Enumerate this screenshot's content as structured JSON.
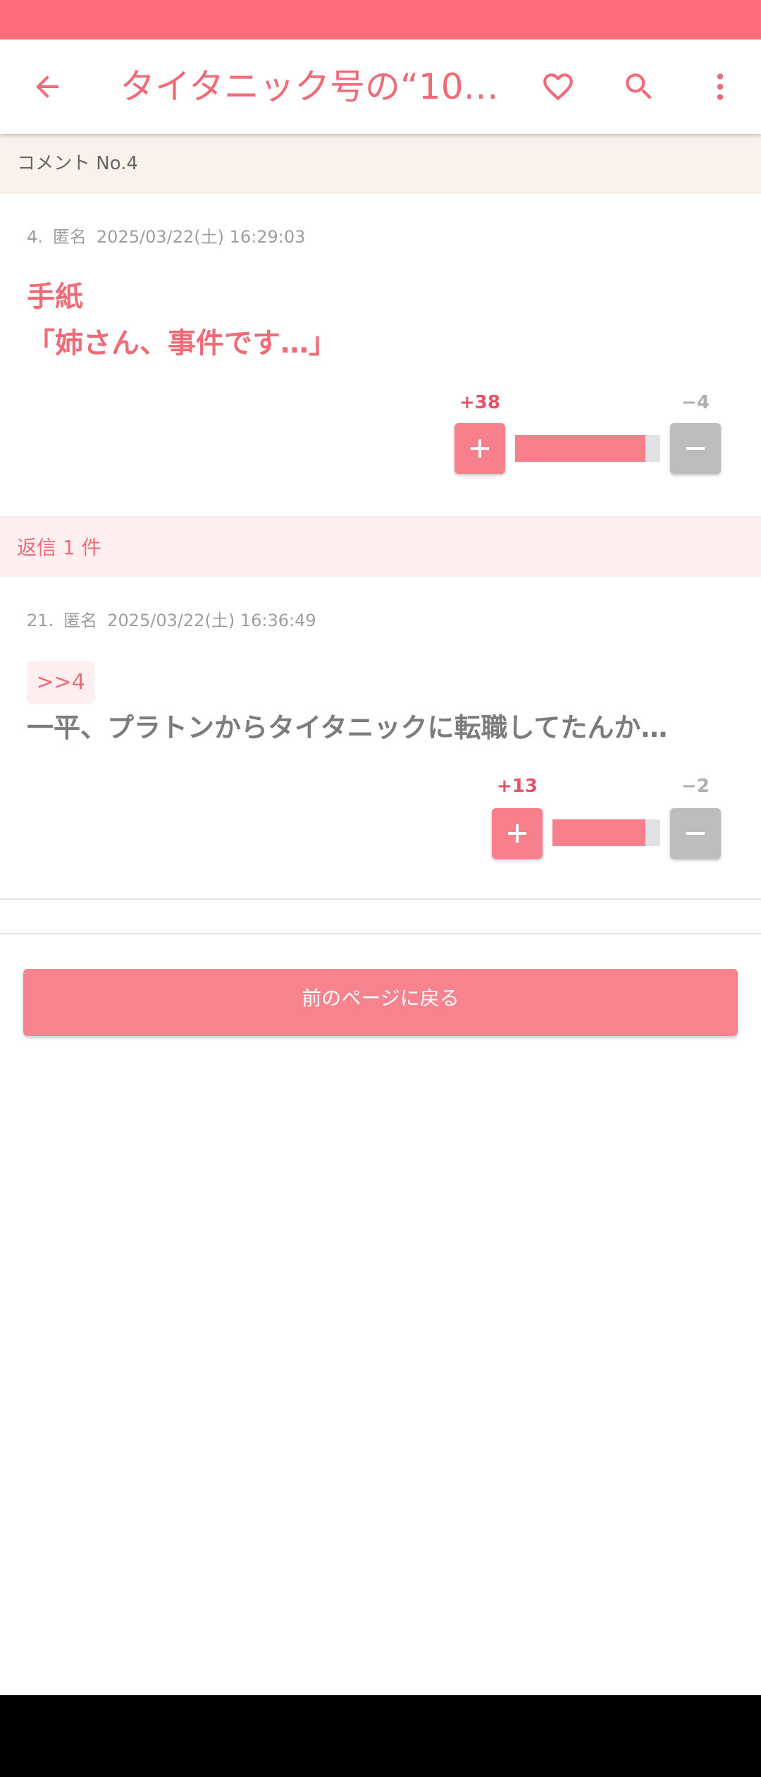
{
  "app_bar": {
    "title": "タイタニック号の“10代…",
    "icons": [
      "arrow-back-icon",
      "heart-outline-icon",
      "search-icon",
      "more-vert-icon"
    ]
  },
  "comment_header": "コメント No.4",
  "comment": {
    "number": "4.",
    "author": "匿名",
    "datetime": "2025/03/22(土) 16:29:03",
    "body_line1": "手紙",
    "body_line2": "「姉さん、事件です…」",
    "plus_count": "+38",
    "minus_count": "−4",
    "plus_ratio": 0.9
  },
  "replies_header": "返信 1 件",
  "reply": {
    "number": "21.",
    "author": "匿名",
    "datetime": "2025/03/22(土) 16:36:49",
    "anchor": ">>4",
    "body": "一平、プラトンからタイタニックに転職してたんか…",
    "plus_count": "+13",
    "minus_count": "−2",
    "plus_ratio": 0.86
  },
  "back_button_label": "前のページに戻る",
  "colors": {
    "accent": "#F06B78",
    "status_bar": "#FF6B78",
    "button": "#F7838E",
    "minus_gray": "#BDBDBD"
  }
}
